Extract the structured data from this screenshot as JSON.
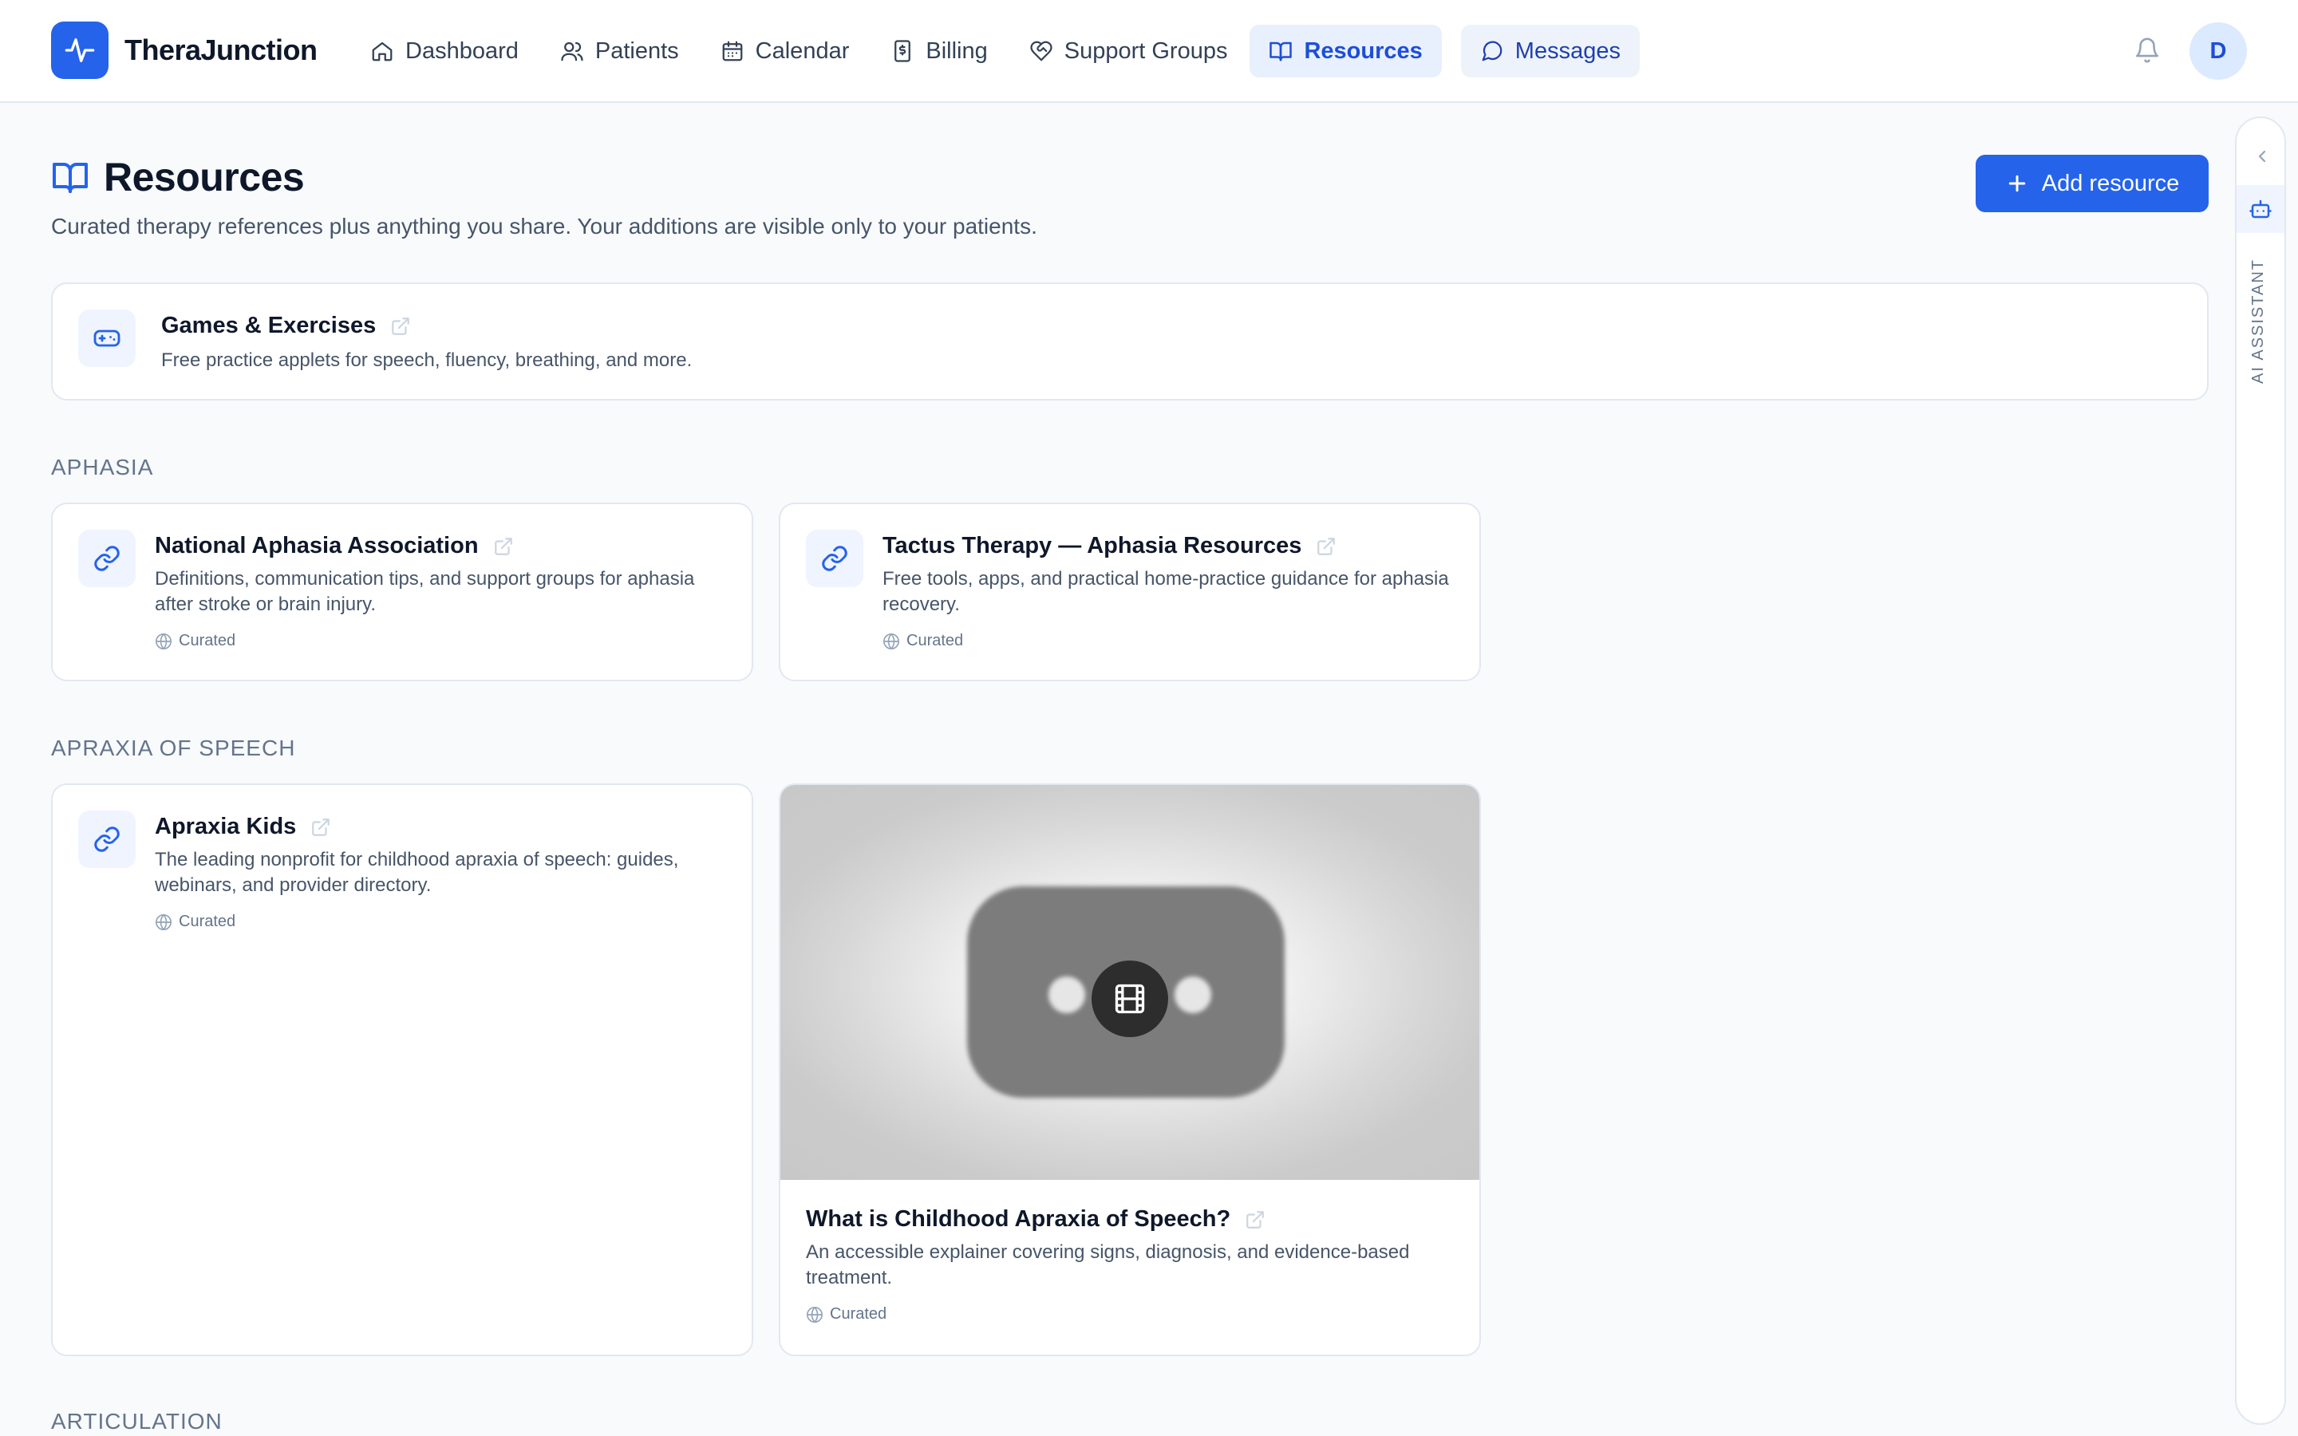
{
  "app": {
    "name": "TheraJunction"
  },
  "nav": {
    "items": [
      {
        "label": "Dashboard",
        "icon": "home-icon"
      },
      {
        "label": "Patients",
        "icon": "users-icon"
      },
      {
        "label": "Calendar",
        "icon": "calendar-icon"
      },
      {
        "label": "Billing",
        "icon": "receipt-icon"
      },
      {
        "label": "Support Groups",
        "icon": "heart-handshake-icon"
      },
      {
        "label": "Resources",
        "icon": "book-open-icon",
        "active": true
      },
      {
        "label": "Messages",
        "icon": "message-circle-icon"
      }
    ],
    "notifications_icon": "bell-icon",
    "avatar_initial": "D"
  },
  "page": {
    "title": "Resources",
    "subtitle": "Curated therapy references plus anything you share. Your additions are visible only to your patients.",
    "add_button": "Add resource"
  },
  "featured": {
    "title": "Games & Exercises",
    "description": "Free practice applets for speech, fluency, breathing, and more.",
    "icon": "gamepad-icon"
  },
  "sections": [
    {
      "label": "APHASIA",
      "cards": [
        {
          "title": "National Aphasia Association",
          "description": "Definitions, communication tips, and support groups for aphasia after stroke or brain injury.",
          "tag": "Curated",
          "icon": "link-icon"
        },
        {
          "title": "Tactus Therapy — Aphasia Resources",
          "description": "Free tools, apps, and practical home-practice guidance for aphasia recovery.",
          "tag": "Curated",
          "icon": "link-icon"
        }
      ]
    },
    {
      "label": "APRAXIA OF SPEECH",
      "cards": [
        {
          "title": "Apraxia Kids",
          "description": "The leading nonprofit for childhood apraxia of speech: guides, webinars, and provider directory.",
          "tag": "Curated",
          "icon": "link-icon"
        },
        {
          "title": "What is Childhood Apraxia of Speech?",
          "description": "An accessible explainer covering signs, diagnosis, and evidence-based treatment.",
          "tag": "Curated",
          "icon": "film-icon",
          "type": "video"
        }
      ]
    },
    {
      "label": "ARTICULATION",
      "cards": []
    }
  ],
  "assistant": {
    "label": "AI ASSISTANT"
  },
  "colors": {
    "primary": "#2563eb",
    "active_nav_bg": "#e8f0fe",
    "text": "#0f172a",
    "muted": "#64748b"
  }
}
